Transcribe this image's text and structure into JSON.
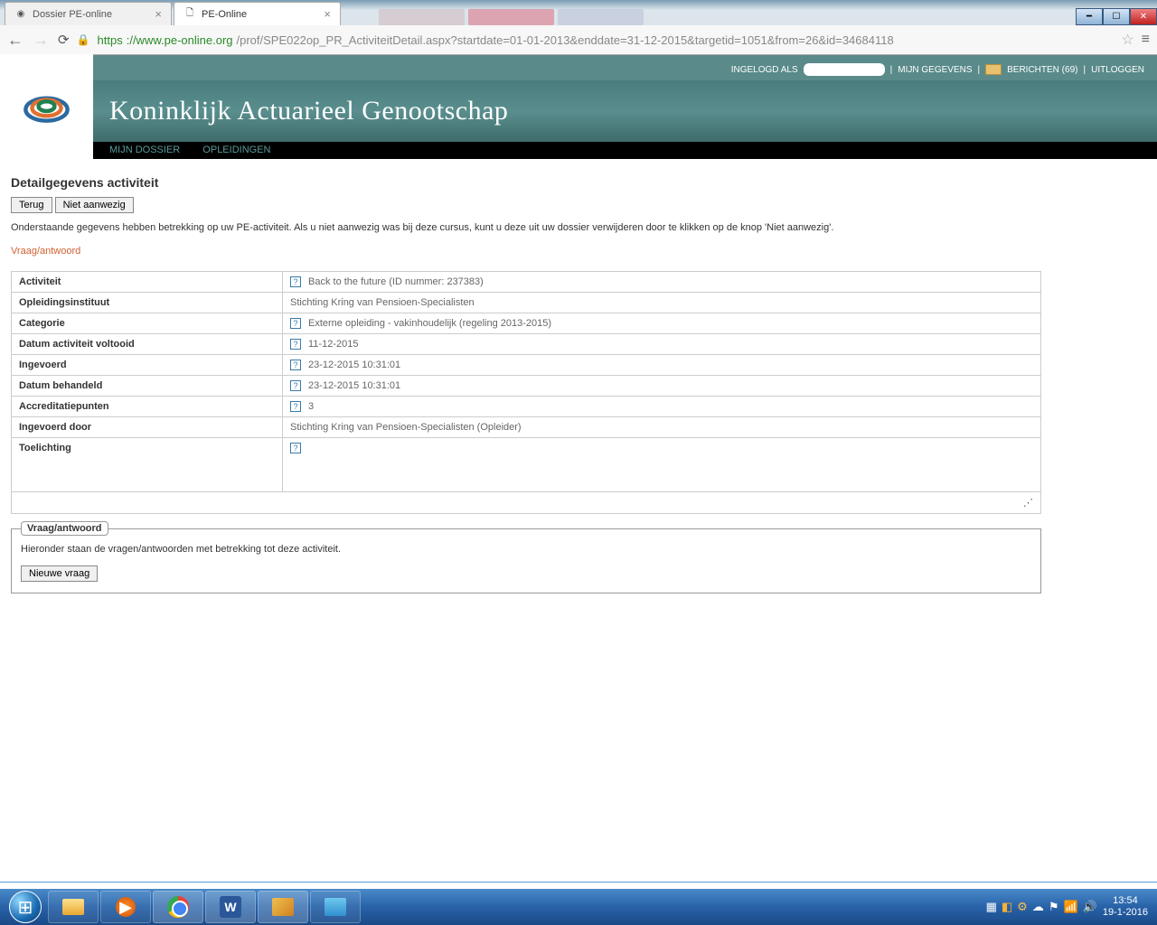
{
  "browser": {
    "tabs": [
      {
        "title": "Dossier PE-online",
        "active": false
      },
      {
        "title": "PE-Online",
        "active": true
      }
    ],
    "url_scheme": "https",
    "url_host": "://www.pe-online.org",
    "url_path": "/prof/SPE022op_PR_ActiviteitDetail.aspx?startdate=01-01-2013&enddate=31-12-2015&targetid=1051&from=26&id=34684118"
  },
  "topbar": {
    "logged_in_as": "INGELOGD ALS",
    "my_data": "MIJN GEGEVENS",
    "messages": "BERICHTEN (69)",
    "logout": "UITLOGGEN",
    "sep": "|"
  },
  "header": {
    "org": "Koninklijk Actuarieel Genootschap"
  },
  "nav": {
    "item1": "MIJN DOSSIER",
    "item2": "OPLEIDINGEN"
  },
  "page": {
    "title": "Detailgegevens activiteit",
    "back_btn": "Terug",
    "absent_btn": "Niet aanwezig",
    "intro": "Onderstaande gegevens hebben betrekking op uw PE-activiteit. Als u niet aanwezig was bij deze cursus, kunt u deze uit uw dossier verwijderen door te klikken op de knop 'Niet aanwezig'.",
    "qa_link": "Vraag/antwoord"
  },
  "details": {
    "rows": [
      {
        "label": "Activiteit",
        "help": true,
        "value": "Back to the future (ID nummer: 237383)"
      },
      {
        "label": "Opleidingsinstituut",
        "help": false,
        "value": "Stichting Kring van Pensioen-Specialisten"
      },
      {
        "label": "Categorie",
        "help": true,
        "value": "Externe opleiding - vakinhoudelijk (regeling 2013-2015)"
      },
      {
        "label": "Datum activiteit voltooid",
        "help": true,
        "value": "11-12-2015"
      },
      {
        "label": "Ingevoerd",
        "help": true,
        "value": "23-12-2015 10:31:01"
      },
      {
        "label": "Datum behandeld",
        "help": true,
        "value": "23-12-2015 10:31:01"
      },
      {
        "label": "Accreditatiepunten",
        "help": true,
        "value": "3"
      },
      {
        "label": "Ingevoerd door",
        "help": false,
        "value": "Stichting Kring van Pensioen-Specialisten (Opleider)"
      },
      {
        "label": "Toelichting",
        "help": true,
        "value": ""
      }
    ]
  },
  "qa": {
    "legend": "Vraag/antwoord",
    "intro": "Hieronder staan de vragen/antwoorden met betrekking tot deze activiteit.",
    "new_btn": "Nieuwe vraag"
  },
  "taskbar": {
    "time": "13:54",
    "date": "19-1-2016"
  }
}
